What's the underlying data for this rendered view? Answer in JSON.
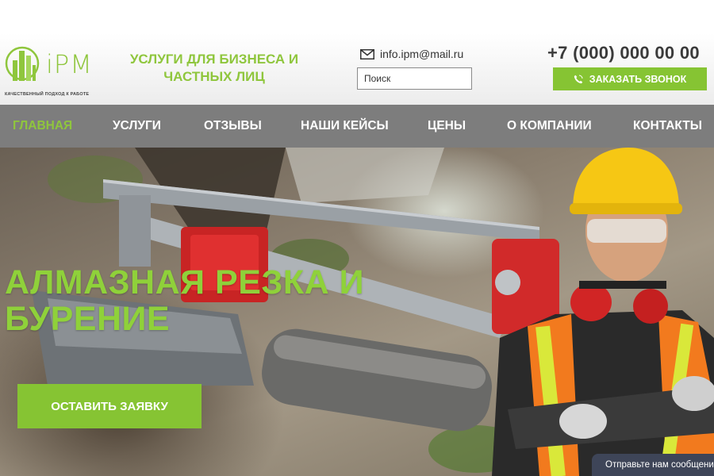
{
  "header": {
    "logo_text": "iPM",
    "logo_tagline": "КАЧЕСТВЕННЫЙ ПОДХОД К РАБОТЕ",
    "tagline": "УСЛУГИ ДЛЯ БИЗНЕСА И ЧАСТНЫХ ЛИЦ",
    "email": "info.ipm@mail.ru",
    "search_placeholder": "Поиск",
    "phone": "+7 (000) 000 00 00",
    "call_button_label": "ЗАКАЗАТЬ ЗВОНОК"
  },
  "nav": {
    "items": [
      {
        "label": "ГЛАВНАЯ",
        "active": true
      },
      {
        "label": "УСЛУГИ",
        "active": false
      },
      {
        "label": "ОТЗЫВЫ",
        "active": false
      },
      {
        "label": "НАШИ КЕЙСЫ",
        "active": false
      },
      {
        "label": "ЦЕНЫ",
        "active": false
      },
      {
        "label": "О КОМПАНИИ",
        "active": false
      },
      {
        "label": "КОНТАКТЫ",
        "active": false
      }
    ]
  },
  "hero": {
    "title_line1": "АЛМАЗНАЯ РЕЗКА И",
    "title_line2": "БУРЕНИЕ",
    "cta_label": "ОСТАВИТЬ ЗАЯВКУ"
  },
  "chat": {
    "label": "Отправьте нам сообщение"
  },
  "colors": {
    "accent": "#86c433",
    "nav_bg": "#7d7d7d",
    "chat_bg": "#3e4558"
  },
  "icons": [
    "logo-mark-icon",
    "envelope-icon",
    "phone-handset-icon",
    "chat-envelope-icon"
  ]
}
